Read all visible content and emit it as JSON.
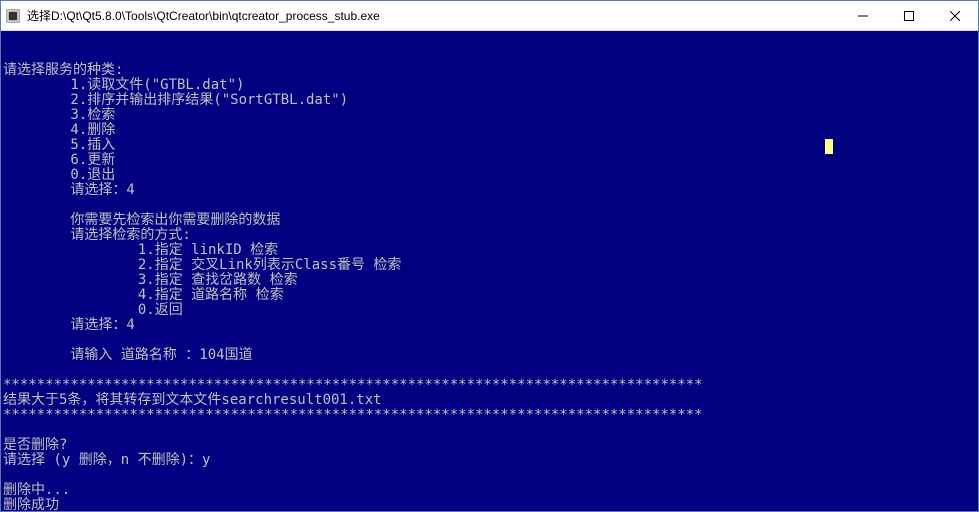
{
  "window": {
    "title": "选择D:\\Qt\\Qt5.8.0\\Tools\\QtCreator\\bin\\qtcreator_process_stub.exe"
  },
  "console": {
    "lines": [
      "请选择服务的种类:",
      "        1.读取文件(\"GTBL.dat\")",
      "        2.排序并输出排序结果(\"SortGTBL.dat\")",
      "        3.检索",
      "        4.删除",
      "        5.插入",
      "        6.更新",
      "        0.退出",
      "        请选择：4",
      "",
      "        你需要先检索出你需要删除的数据",
      "        请选择检索的方式:",
      "                1.指定 linkID 检索",
      "                2.指定 交叉Link列表示Class番号 检索",
      "                3.指定 查找岔路数 检索",
      "                4.指定 道路名称 检索",
      "                0.返回",
      "        请选择：4",
      "",
      "        请输入 道路名称 ：104国道",
      "",
      "***********************************************************************************",
      "结果大于5条，将其转存到文本文件searchresult001.txt",
      "***********************************************************************************",
      "",
      "是否删除?",
      "请选择 (y 删除，n 不删除)：y",
      "",
      "删除中...",
      "删除成功"
    ]
  }
}
